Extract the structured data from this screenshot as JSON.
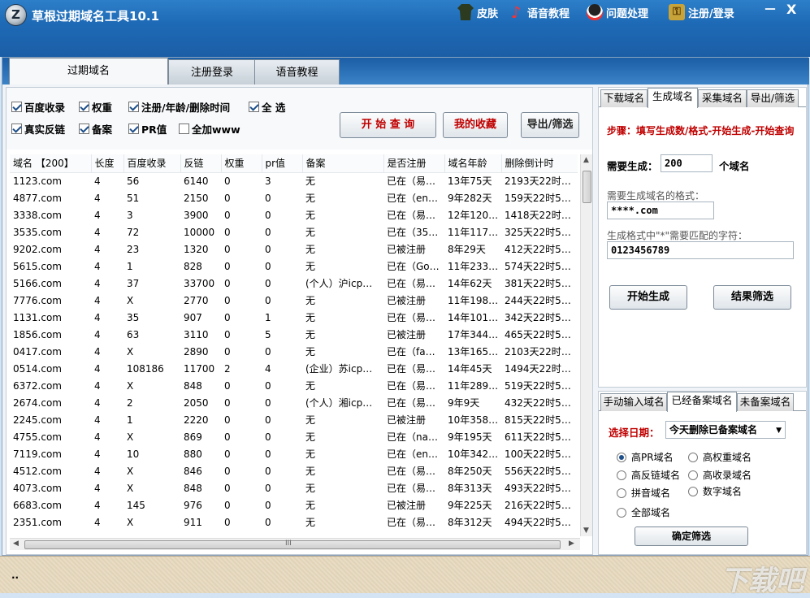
{
  "app": {
    "title": "草根过期域名工具10.1",
    "logo_char": "Z",
    "toolbar": {
      "skin": "皮肤",
      "voice": "语音教程",
      "help": "问题处理",
      "register": "注册/登录"
    },
    "minimize": "－",
    "close": "X"
  },
  "main_tabs": [
    "过期域名",
    "注册登录",
    "语音教程"
  ],
  "options": {
    "baidu": "百度收录",
    "weight": "权重",
    "reg_age_del": "注册/年龄/删除时间",
    "select_all": "全 选",
    "real_backlink": "真实反链",
    "icp": "备案",
    "pr": "PR值",
    "add_www": "全加www"
  },
  "buttons": {
    "start_query": "开 始 查 询",
    "favorites": "我的收藏",
    "export_filter": "导出/筛选"
  },
  "grid": {
    "headers": [
      "域名 【200】",
      "长度",
      "百度收录",
      "反链",
      "权重",
      "pr值",
      "备案",
      "是否注册",
      "域名年龄",
      "删除倒计时"
    ],
    "rows": [
      [
        "1123.com",
        "4",
        "56",
        "6140",
        "0",
        "3",
        "无",
        "已在（易…",
        "13年75天",
        "2193天22时5…"
      ],
      [
        "4877.com",
        "4",
        "51",
        "2150",
        "0",
        "0",
        "无",
        "已在（en…",
        "9年282天",
        "159天22时59…"
      ],
      [
        "3338.com",
        "4",
        "3",
        "3900",
        "0",
        "0",
        "无",
        "已在（易…",
        "12年120…",
        "1418天22时5…"
      ],
      [
        "3535.com",
        "4",
        "72",
        "10000",
        "0",
        "0",
        "无",
        "已在（35…",
        "11年117…",
        "325天22时59…"
      ],
      [
        "9202.com",
        "4",
        "23",
        "1320",
        "0",
        "0",
        "无",
        "已被注册",
        "8年29天",
        "412天22时59…"
      ],
      [
        "5615.com",
        "4",
        "1",
        "828",
        "0",
        "0",
        "无",
        "已在（Go…",
        "11年233…",
        "574天22时59…"
      ],
      [
        "5166.com",
        "4",
        "37",
        "33700",
        "0",
        "0",
        "(个人）沪icp…",
        "已在（易…",
        "14年62天",
        "381天22时59…"
      ],
      [
        "7776.com",
        "4",
        "X",
        "2770",
        "0",
        "0",
        "无",
        "已被注册",
        "11年198…",
        "244天22时59…"
      ],
      [
        "1131.com",
        "4",
        "35",
        "907",
        "0",
        "1",
        "无",
        "已在（易…",
        "14年101…",
        "342天22时59…"
      ],
      [
        "1856.com",
        "4",
        "63",
        "3110",
        "0",
        "5",
        "无",
        "已被注册",
        "17年344…",
        "465天22时59…"
      ],
      [
        "0417.com",
        "4",
        "X",
        "2890",
        "0",
        "0",
        "无",
        "已在（fa…",
        "13年165…",
        "2103天22时5…"
      ],
      [
        "0514.com",
        "4",
        "108186",
        "11700",
        "2",
        "4",
        "(企业）苏icp…",
        "已在（易…",
        "14年45天",
        "1494天22时5…"
      ],
      [
        "6372.com",
        "4",
        "X",
        "848",
        "0",
        "0",
        "无",
        "已在（易…",
        "11年289…",
        "519天22时59…"
      ],
      [
        "2674.com",
        "4",
        "2",
        "2050",
        "0",
        "0",
        "(个人）湘icp…",
        "已在（易…",
        "9年9天",
        "432天22时59…"
      ],
      [
        "2245.com",
        "4",
        "1",
        "2220",
        "0",
        "0",
        "无",
        "已被注册",
        "10年358…",
        "815天22时59…"
      ],
      [
        "4755.com",
        "4",
        "X",
        "869",
        "0",
        "0",
        "无",
        "已在（na…",
        "9年195天",
        "611天22时59…"
      ],
      [
        "7119.com",
        "4",
        "10",
        "880",
        "0",
        "0",
        "无",
        "已在（en…",
        "10年342…",
        "100天22时59…"
      ],
      [
        "4512.com",
        "4",
        "X",
        "846",
        "0",
        "0",
        "无",
        "已在（易…",
        "8年250天",
        "556天22时59…"
      ],
      [
        "4073.com",
        "4",
        "X",
        "848",
        "0",
        "0",
        "无",
        "已在（易…",
        "8年313天",
        "493天22时59…"
      ],
      [
        "6683.com",
        "4",
        "145",
        "976",
        "0",
        "0",
        "无",
        "已被注册",
        "9年225天",
        "216天22时59…"
      ],
      [
        "2351.com",
        "4",
        "X",
        "911",
        "0",
        "0",
        "无",
        "已在（易…",
        "8年312天",
        "494天22时59…"
      ]
    ]
  },
  "scroll": {
    "hthumb": "III"
  },
  "right_top": {
    "tabs": [
      "下载域名",
      "生成域名",
      "采集域名",
      "导出/筛选"
    ],
    "steps": "步骤：填写生成数/格式-开始生成-开始查询",
    "need_gen_label": "需要生成：",
    "need_gen_value": "200",
    "need_gen_unit": "个域名",
    "format_label": "需要生成域名的格式：",
    "format_value": "****.com",
    "chars_label": "生成格式中\"*\"需要匹配的字符：",
    "chars_value": "0123456789",
    "start_gen": "开始生成",
    "result_filter": "结果筛选"
  },
  "right_bottom": {
    "tabs": [
      "手动输入域名",
      "已经备案域名",
      "未备案域名"
    ],
    "date_label": "选择日期：",
    "date_value": "今天删除已备案域名",
    "radios": [
      "高PR域名",
      "高权重域名",
      "高反链域名",
      "高收录域名",
      "拼音域名",
      "数字域名",
      "全部域名"
    ],
    "confirm": "确定筛选"
  },
  "status": {
    "text": "..",
    "watermark": "下载吧"
  }
}
